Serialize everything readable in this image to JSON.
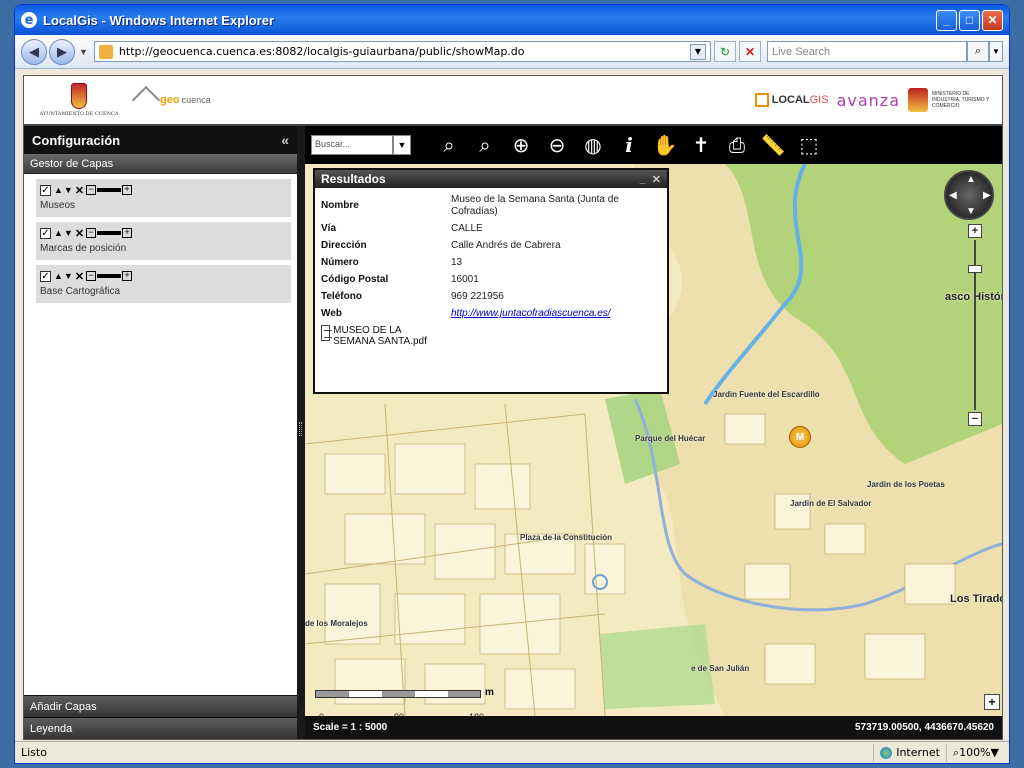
{
  "window": {
    "title": "LocalGis - Windows Internet Explorer"
  },
  "addressbar": {
    "url": "http://geocuenca.cuenca.es:8082/localgis-guiaurbana/public/showMap.do",
    "search_placeholder": "Live Search"
  },
  "banner": {
    "ayto_text": "AYUNTAMIENTO DE CUENCA",
    "geo_a": "geo",
    "geo_b": "cuenca",
    "localgis_a": "LOCAL",
    "localgis_b": "GIS",
    "avanza": "avanza",
    "ministerio": "MINISTERIO DE INDUSTRIA, TURISMO Y COMERCIO"
  },
  "sidebar": {
    "title": "Configuración",
    "collapse": "«",
    "section": "Gestor de Capas",
    "layers": [
      {
        "name": "Museos"
      },
      {
        "name": "Marcas de posición"
      },
      {
        "name": "Base Cartográfica"
      }
    ],
    "footer_add": "Añadir Capas",
    "footer_legend": "Leyenda"
  },
  "toolbar": {
    "search_placeholder": "Buscar...",
    "tools": [
      {
        "name": "search-icon",
        "glyph": "⌕"
      },
      {
        "name": "zoom-out-icon",
        "glyph": "⌕"
      },
      {
        "name": "zoom-box-in-icon",
        "glyph": "⊕"
      },
      {
        "name": "zoom-box-out-icon",
        "glyph": "⊖"
      },
      {
        "name": "globe-icon",
        "glyph": "◍"
      },
      {
        "name": "info-icon",
        "glyph": "i"
      },
      {
        "name": "pan-hand-icon",
        "glyph": "✋"
      },
      {
        "name": "pin-icon",
        "glyph": "✝"
      },
      {
        "name": "print-icon",
        "glyph": "⎙"
      },
      {
        "name": "ruler-icon",
        "glyph": "📏"
      },
      {
        "name": "measure-area-icon",
        "glyph": "⬚"
      }
    ]
  },
  "results": {
    "title": "Resultados",
    "minimize": "_",
    "close": "✕",
    "fields": [
      {
        "key": "Nombre",
        "value": "Museo de la Semana Santa (Junta de Cofradías)"
      },
      {
        "key": "Vía",
        "value": "CALLE"
      },
      {
        "key": "Dirección",
        "value": "Calle Andrés de Cabrera"
      },
      {
        "key": "Número",
        "value": "13"
      },
      {
        "key": "Código Postal",
        "value": "16001"
      },
      {
        "key": "Teléfono",
        "value": "969 221956"
      },
      {
        "key": "Web",
        "value": "http://www.juntacofradiascuenca.es/"
      }
    ],
    "attachment": "MUSEO DE LA SEMANA SANTA.pdf"
  },
  "map": {
    "labels": [
      "asco Histórico",
      "Jardin Fuente del Escardillo",
      "Parque del Huécar",
      "Jardin de los Poetas",
      "Jardin de El Salvador",
      "Plaza de la Constitución",
      "Los Tiradores",
      "de los Moralejos",
      "e de San Julián"
    ],
    "marker": "M",
    "scale_ticks": [
      "0",
      "90",
      "180"
    ],
    "scale_unit": "m"
  },
  "status": {
    "scale": "Scale = 1 : 5000",
    "coords": "573719.00500, 4436670.45620"
  },
  "ie_status": {
    "text": "Listo",
    "zone": "Internet",
    "zoom": "100%"
  }
}
